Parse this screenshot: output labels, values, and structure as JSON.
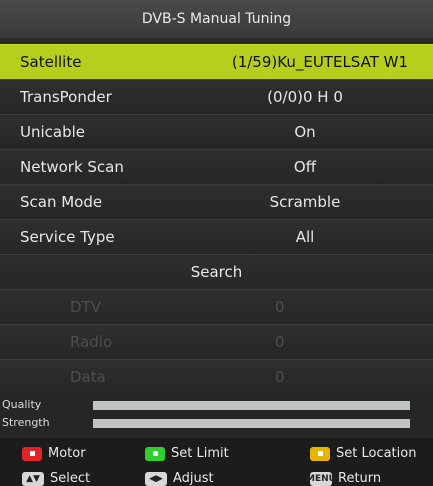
{
  "title": "DVB-S Manual Tuning",
  "menu": [
    {
      "label": "Satellite",
      "value": "(1/59)Ku_EUTELSAT W1"
    },
    {
      "label": "TransPonder",
      "value": "(0/0)0 H 0"
    },
    {
      "label": "Unicable",
      "value": "On"
    },
    {
      "label": "Network Scan",
      "value": "Off"
    },
    {
      "label": "Scan Mode",
      "value": "Scramble"
    },
    {
      "label": "Service Type",
      "value": "All"
    }
  ],
  "search_label": "Search",
  "counts": [
    {
      "label": "DTV",
      "value": "0"
    },
    {
      "label": "Radio",
      "value": "0"
    },
    {
      "label": "Data",
      "value": "0"
    }
  ],
  "meters": [
    {
      "label": "Quality",
      "level": 1.0
    },
    {
      "label": "Strength",
      "level": 1.0
    }
  ],
  "legend": {
    "motor": "Motor",
    "set_limit": "Set Limit",
    "set_location": "Set Location",
    "select": "Select",
    "adjust": "Adjust",
    "menu_key": "MENU",
    "return": "Return"
  },
  "colors": {
    "highlight": "#b6cf1c",
    "red": "#e2232a",
    "green": "#2fcf2f",
    "yellow": "#e8b400"
  }
}
